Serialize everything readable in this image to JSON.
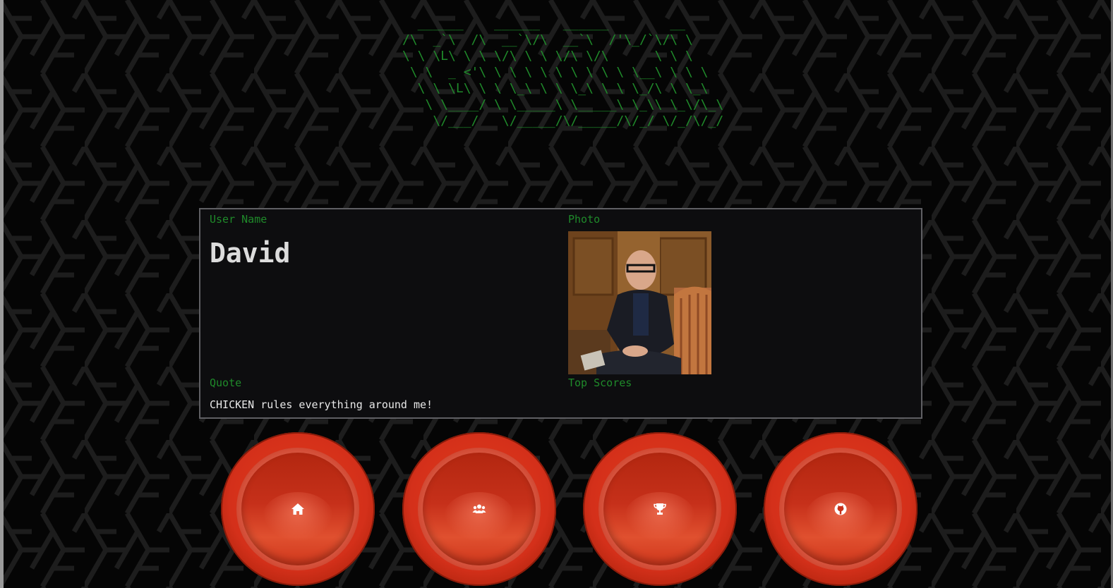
{
  "ascii_logo": "  ______    ______   ______        __\n/\\  _`\\  /\\  __`\\/\\  __`\\  /'\\_/`\\/\\ \\\n\\ \\ \\L\\ \\ \\ \\/\\ \\ \\ \\/\\ \\/\\      \\ \\ \\\n \\ \\  _ <'\\ \\ \\ \\ \\ \\ \\ \\ \\ \\ \\__\\ \\ \\ \\\n  \\ \\ \\L\\ \\ \\ \\_\\ \\ \\ \\_\\ \\ \\ \\_/\\ \\ \\_\\\n   \\ \\____/ \\ \\_____\\ \\_____\\ \\_\\\\ \\_\\/\\_\\\n    \\/___/   \\/_____/\\/_____/\\/_/ \\/_/\\/_/",
  "profile": {
    "username_label": "User Name",
    "username": "David",
    "photo_label": "Photo",
    "quote_label": "Quote",
    "quote": "CHICKEN rules everything around me!",
    "top_scores_label": "Top Scores"
  },
  "nav_buttons": [
    {
      "icon": "home-icon"
    },
    {
      "icon": "users-icon"
    },
    {
      "icon": "trophy-icon"
    },
    {
      "icon": "github-icon"
    }
  ],
  "colors": {
    "accent_green": "#1f8a2a",
    "button_red": "#d4301a",
    "card_bg": "#0d0d0f"
  }
}
